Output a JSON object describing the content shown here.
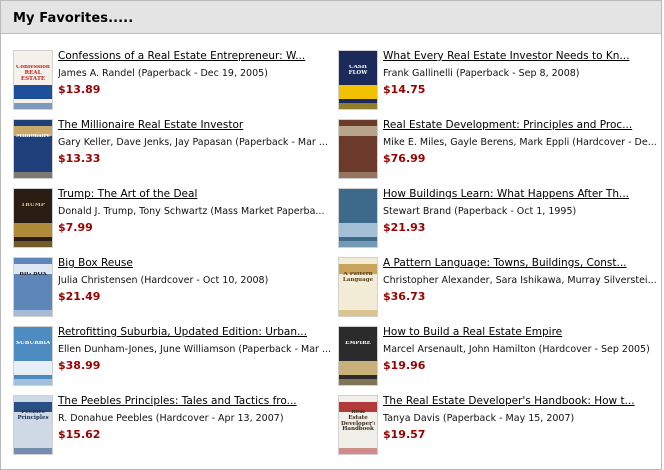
{
  "header": {
    "title": "My Favorites....."
  },
  "items": [
    {
      "title": "Confessions of a Real Estate Entrepreneur: W...",
      "meta": "James A. Randel (Paperback - Dec 19, 2005)",
      "price": "$13.89",
      "cover": {
        "bg": "#f4f1ea",
        "band": "#1d4f9a",
        "text": "Confessions REAL ESTATE",
        "text_color": "#c62828"
      }
    },
    {
      "title": "What Every Real Estate Investor Needs to Kn...",
      "meta": "Frank Gallinelli (Paperback - Sep 8, 2008)",
      "price": "$14.75",
      "cover": {
        "bg": "#1b2a5a",
        "band": "#f2c200",
        "text": "CASH FLOW",
        "text_color": "#ffffff"
      }
    },
    {
      "title": "The Millionaire Real Estate Investor",
      "meta": "Gary Keller, Dave Jenks, Jay Papasan (Paperback - Mar ...",
      "price": "$13.33",
      "cover": {
        "bg": "#1f3f7a",
        "band": "#c9a96a",
        "text": "Millionaire",
        "text_color": "#ffffff"
      }
    },
    {
      "title": "Real Estate Development: Principles and Proc...",
      "meta": "Mike E. Miles, Gayle Berens, Mark Eppli (Hardcover - De...",
      "price": "$76.99",
      "cover": {
        "bg": "#6b3a2a",
        "band": "#b7a48a",
        "text": "",
        "text_color": "#ffffff"
      }
    },
    {
      "title": "Trump: The Art of the Deal",
      "meta": "Donald J. Trump, Tony Schwartz (Mass Market Paperba...",
      "price": "$7.99",
      "cover": {
        "bg": "#2a1d14",
        "band": "#b08b3a",
        "text": "TRUMP",
        "text_color": "#e0c27a"
      }
    },
    {
      "title": "How Buildings Learn: What Happens After Th...",
      "meta": "Stewart Brand (Paperback - Oct 1, 1995)",
      "price": "$21.93",
      "cover": {
        "bg": "#3d6a8a",
        "band": "#a3c0d6",
        "text": "",
        "text_color": "#ffffff"
      }
    },
    {
      "title": "Big Box Reuse",
      "meta": "Julia Christensen (Hardcover - Oct 10, 2008)",
      "price": "$21.49",
      "cover": {
        "bg": "#5f86b8",
        "band": "#dfe8f2",
        "text": "BIG BOX",
        "text_color": "#1a1a1a"
      }
    },
    {
      "title": "A Pattern Language: Towns, Buildings, Const...",
      "meta": "Christopher Alexander, Sara Ishikawa, Murray Silverstei...",
      "price": "$36.73",
      "cover": {
        "bg": "#f3ecd6",
        "band": "#c8a45a",
        "text": "A Pattern Language",
        "text_color": "#5a3b1a"
      }
    },
    {
      "title": "Retrofitting Suburbia, Updated Edition: Urban...",
      "meta": "Ellen Dunham-Jones, June Williamson (Paperback - Mar ...",
      "price": "$38.99",
      "cover": {
        "bg": "#4d8bc0",
        "band": "#e6eef6",
        "text": "SUBURBIA",
        "text_color": "#ffffff"
      }
    },
    {
      "title": "How to Build a Real Estate Empire",
      "meta": "Marcel Arsenault, John Hamilton (Hardcover - Sep 2005)",
      "price": "$19.96",
      "cover": {
        "bg": "#2b2b2b",
        "band": "#c9b07a",
        "text": "EMPIRE",
        "text_color": "#ffffff"
      }
    },
    {
      "title": "The Peebles Principles: Tales and Tactics fro...",
      "meta": "R. Donahue Peebles (Hardcover - Apr 13, 2007)",
      "price": "$15.62",
      "cover": {
        "bg": "#cfd9e6",
        "band": "#2a4f84",
        "text": "Peebles Principles",
        "text_color": "#1c2f55"
      }
    },
    {
      "title": "The Real Estate Developer's Handbook: How t...",
      "meta": "Tanya Davis (Paperback - May 15, 2007)",
      "price": "$19.57",
      "cover": {
        "bg": "#f1efe9",
        "band": "#b23a3a",
        "text": "Real Estate Developer's Handbook",
        "text_color": "#3a2a1a"
      }
    }
  ]
}
